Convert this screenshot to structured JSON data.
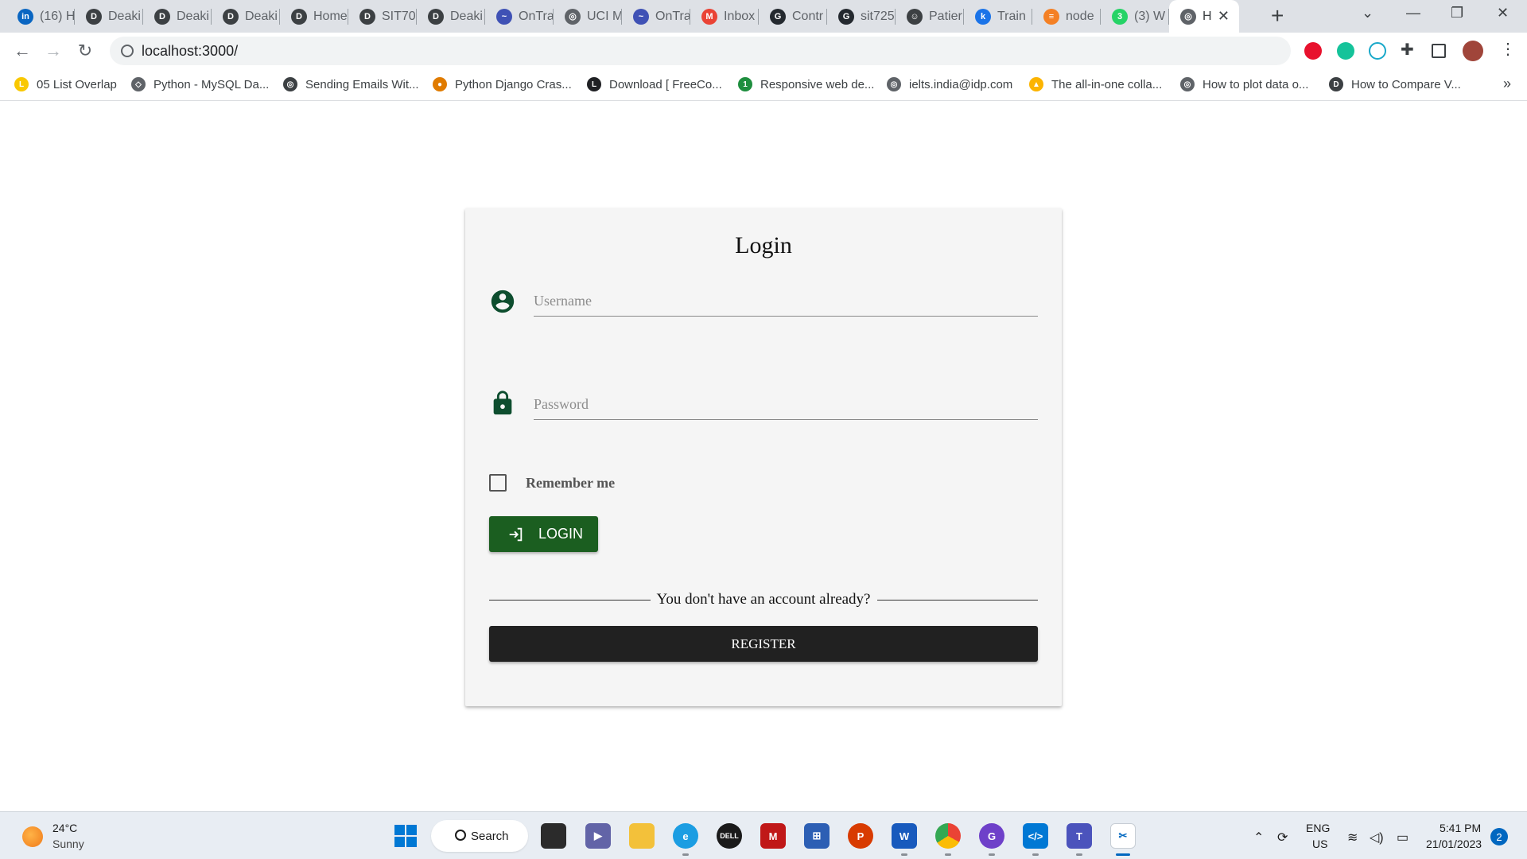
{
  "browser": {
    "tabs": [
      {
        "label": "(16) H",
        "icon": "linkedin-icon",
        "color": "#0a66c2",
        "glyph": "in"
      },
      {
        "label": "Deaki",
        "icon": "deakin-icon",
        "color": "#3c4043",
        "glyph": "D"
      },
      {
        "label": "Deaki",
        "icon": "deakin-icon",
        "color": "#3c4043",
        "glyph": "D"
      },
      {
        "label": "Deaki",
        "icon": "deakin-icon",
        "color": "#3c4043",
        "glyph": "D"
      },
      {
        "label": "Home",
        "icon": "deakin-icon",
        "color": "#3c4043",
        "glyph": "D"
      },
      {
        "label": "SIT70",
        "icon": "deakin-icon",
        "color": "#3c4043",
        "glyph": "D"
      },
      {
        "label": "Deaki",
        "icon": "deakin-icon",
        "color": "#3c4043",
        "glyph": "D"
      },
      {
        "label": "OnTra",
        "icon": "ontrack-icon",
        "color": "#3f51b5",
        "glyph": "~"
      },
      {
        "label": "UCI M",
        "icon": "globe-icon",
        "color": "#5f6368",
        "glyph": "◎"
      },
      {
        "label": "OnTra",
        "icon": "ontrack-icon",
        "color": "#3f51b5",
        "glyph": "~"
      },
      {
        "label": "Inbox",
        "icon": "gmail-icon",
        "color": "#ea4335",
        "glyph": "M"
      },
      {
        "label": "Contr",
        "icon": "github-icon",
        "color": "#24292f",
        "glyph": "G"
      },
      {
        "label": "sit725",
        "icon": "github-icon",
        "color": "#24292f",
        "glyph": "G"
      },
      {
        "label": "Patier",
        "icon": "smiley-icon",
        "color": "#3c4043",
        "glyph": "☺"
      },
      {
        "label": "Train",
        "icon": "k-icon",
        "color": "#1a73e8",
        "glyph": "k"
      },
      {
        "label": "node",
        "icon": "stackoverflow-icon",
        "color": "#f48024",
        "glyph": "≡"
      },
      {
        "label": "(3) W",
        "icon": "whatsapp-icon",
        "color": "#25d366",
        "glyph": "3"
      },
      {
        "label": "H",
        "icon": "globe-icon",
        "color": "#5f6368",
        "glyph": "◎"
      }
    ],
    "address": "localhost:3000/",
    "bookmarks": [
      {
        "label": "05 List Overlap",
        "icon": "l-icon",
        "color": "#f9c800",
        "glyph": "L"
      },
      {
        "label": "Python - MySQL Da...",
        "icon": "diamond-icon",
        "color": "#5f6368",
        "glyph": "◇"
      },
      {
        "label": "Sending Emails Wit...",
        "icon": "globe-icon",
        "color": "#3c4043",
        "glyph": "◎"
      },
      {
        "label": "Python Django Cras...",
        "icon": "person-icon",
        "color": "#e07b00",
        "glyph": "●"
      },
      {
        "label": "Download [ FreeCo...",
        "icon": "l-icon",
        "color": "#202124",
        "glyph": "L"
      },
      {
        "label": "Responsive web de...",
        "icon": "number-icon",
        "color": "#1e8e3e",
        "glyph": "1"
      },
      {
        "label": "ielts.india@idp.com",
        "icon": "globe-icon",
        "color": "#5f6368",
        "glyph": "◎"
      },
      {
        "label": "The all-in-one colla...",
        "icon": "airtable-icon",
        "color": "#fcb400",
        "glyph": "▲"
      },
      {
        "label": "How to plot data o...",
        "icon": "globe-icon",
        "color": "#5f6368",
        "glyph": "◎"
      },
      {
        "label": "How to Compare V...",
        "icon": "deakin-icon",
        "color": "#3c4043",
        "glyph": "D"
      }
    ],
    "bookmarks_more": "»"
  },
  "login": {
    "title": "Login",
    "username_placeholder": "Username",
    "password_placeholder": "Password",
    "remember_label": "Remember me",
    "login_button": "LOGIN",
    "divider_text": "You don't have an account already?",
    "register_button": "REGISTER",
    "accent_color": "#1b5e20",
    "icon_color": "#0d4d2e"
  },
  "taskbar": {
    "weather_temp": "24°C",
    "weather_desc": "Sunny",
    "search_label": "Search",
    "language": "ENG",
    "region": "US",
    "time": "5:41 PM",
    "date": "21/01/2023",
    "notifications": "2"
  }
}
